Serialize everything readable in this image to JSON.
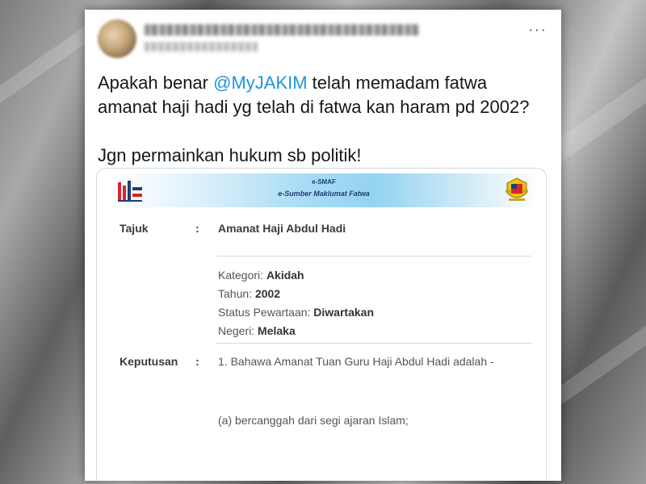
{
  "tweet": {
    "more_label": "···",
    "lines": [
      {
        "before": "Apakah benar ",
        "mention": "@MyJAKIM",
        "after": " telah memadam fatwa"
      },
      "amanat haji hadi yg telah di fatwa kan  haram pd 2002?",
      "Jgn permainkan hukum sb politik!"
    ]
  },
  "document": {
    "banner": {
      "title": "e-SMAF",
      "subtitle": "e-Sumber Maklumat Fatwa"
    },
    "tajuk": {
      "label": "Tajuk",
      "colon": ":",
      "value": "Amanat Haji Abdul Hadi"
    },
    "meta": [
      {
        "label": "Kategori: ",
        "value": "Akidah"
      },
      {
        "label": "Tahun: ",
        "value": "2002"
      },
      {
        "label": "Status Pewartaan: ",
        "value": "Diwartakan"
      },
      {
        "label": "Negeri: ",
        "value": "Melaka"
      }
    ],
    "keputusan": {
      "label": "Keputusan",
      "colon": ":",
      "line1": "1. Bahawa Amanat Tuan Guru Haji Abdul Hadi adalah -",
      "line2": "(a) bercanggah dari segi ajaran Islam;"
    }
  },
  "colors": {
    "mention": "#1b95e0",
    "text": "#14171a",
    "banner_text": "#1e3f72"
  }
}
